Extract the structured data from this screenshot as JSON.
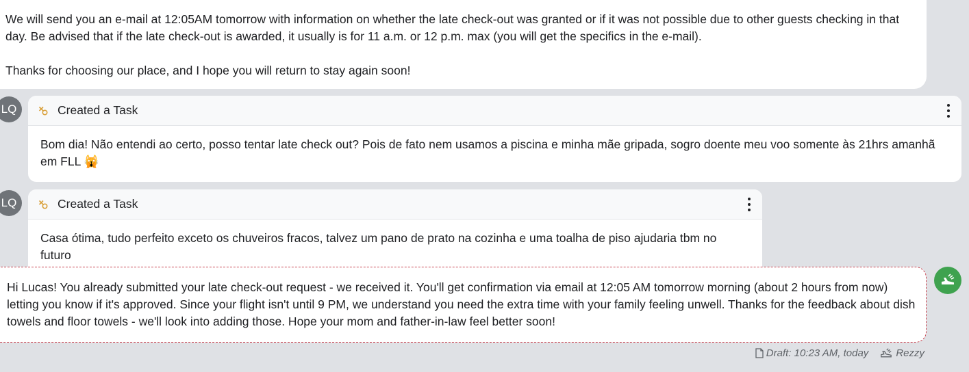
{
  "previous_message": {
    "line1": "We will send you an e-mail at 12:05AM tomorrow with information on whether the late check-out was granted or if it was not possible due to other guests checking in that day. Be advised that if the late check-out is awarded, it usually is for 11 a.m. or 12 p.m. max (you will get the specifics in the e-mail).",
    "line2": "Thanks for choosing our place, and I hope you will return to stay again soon!"
  },
  "tasks": [
    {
      "avatar": "LQ",
      "title": "Created a Task",
      "body": "Bom dia! Não entendi ao certo, posso tentar late check out? Pois de fato nem usamos a piscina e minha mãe gripada, sogro doente meu voo somente às 21hrs amanhã em FLL 🙀"
    },
    {
      "avatar": "LQ",
      "title": "Created a Task",
      "body": "Casa ótima, tudo perfeito exceto os chuveiros fracos, talvez um pano de prato na cozinha e uma toalha de piso ajudaria tbm no futuro"
    }
  ],
  "draft": {
    "text": "Hi Lucas! You already submitted your late check-out request - we received it. You'll get confirmation via email at 12:05 AM tomorrow morning (about 2 hours from now) letting you know if it's approved. Since your flight isn't until 9 PM, we understand you need the extra time with your family feeling unwell. Thanks for the feedback about dish towels and floor towels - we'll look into adding those. Hope your mom and father-in-law feel better soon!",
    "status": "Draft: 10:23 AM, today",
    "author": "Rezzy"
  },
  "colors": {
    "background": "#dfe1e5",
    "draft_border": "#c7424f",
    "bot_avatar": "#3fa24f",
    "task_icon": "#d9a03a"
  },
  "icons": [
    "task-icon",
    "more-vertical-icon",
    "document-icon",
    "rezzy-bot-icon"
  ]
}
